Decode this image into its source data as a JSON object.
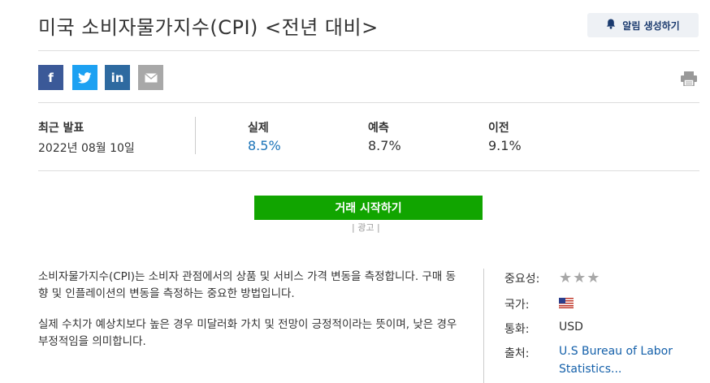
{
  "header": {
    "title": "미국 소비자물가지수(CPI) <전년 대비>",
    "alert_label": "알림 생성하기"
  },
  "share": {
    "facebook": "f",
    "twitter": "t",
    "linkedin": "in",
    "mail": "✉"
  },
  "release": {
    "latest_label": "최근 발표",
    "latest_date": "2022년 08월 10일",
    "actual_label": "실제",
    "actual_value": "8.5%",
    "forecast_label": "예측",
    "forecast_value": "8.7%",
    "previous_label": "이전",
    "previous_value": "9.1%"
  },
  "trade_button": "거래 시작하기",
  "ad_label": "| 광고 |",
  "description": {
    "p1": "소비자물가지수(CPI)는 소비자 관점에서의 상품 및 서비스 가격 변동을 측정합니다. 구매 동향 및 인플레이션의 변동을 측정하는 중요한 방법입니다.",
    "p2": "실제 수치가 예상치보다 높은 경우 미달러화 가치 및 전망이 긍정적이라는 뜻이며, 낮은 경우 부정적임을 의미합니다."
  },
  "info": {
    "importance_label": "중요성:",
    "importance_stars": "★★★",
    "country_label": "국가:",
    "currency_label": "통화:",
    "currency_value": "USD",
    "source_label": "출처:",
    "source_value": "U.S Bureau of Labor Statistics..."
  },
  "colors": {
    "accent": "#1a73b8",
    "trade": "#11a500",
    "facebook": "#3b5998",
    "twitter": "#1da1f2",
    "linkedin": "#2e6aa0"
  },
  "icons": {
    "alert": "bell-icon",
    "print": "printer-icon",
    "flag": "us-flag-icon"
  }
}
